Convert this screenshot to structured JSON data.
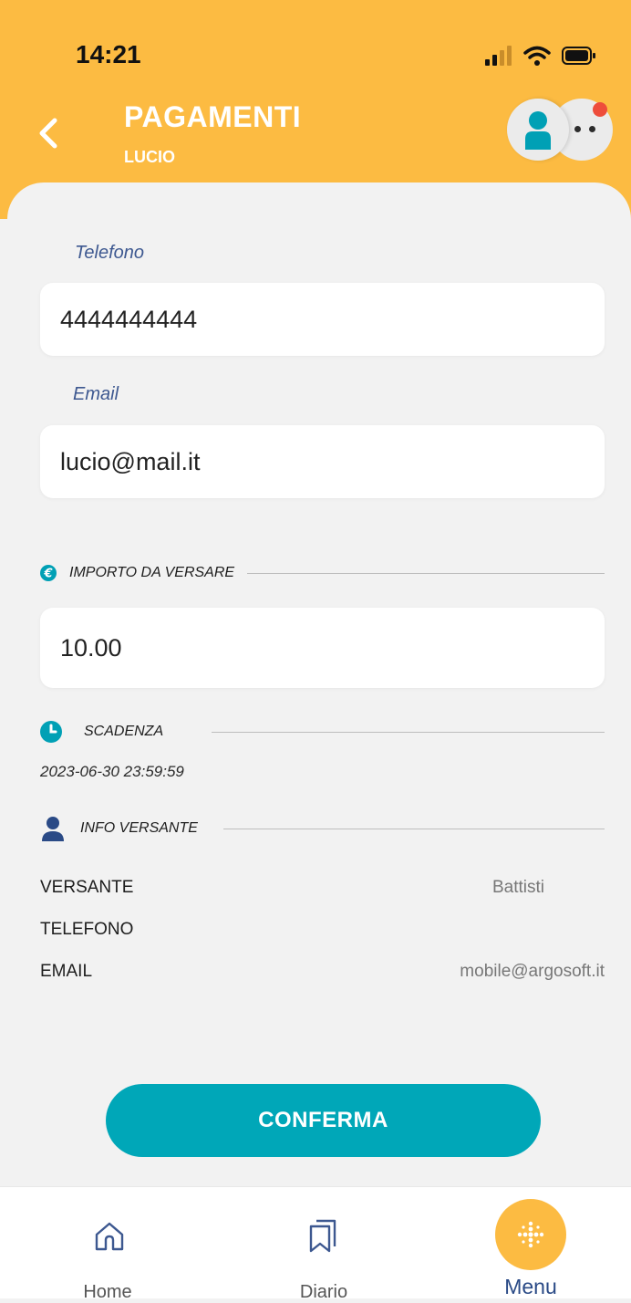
{
  "status_bar": {
    "time": "14:21"
  },
  "header": {
    "title": "PAGAMENTI",
    "subtitle": "LUCIO"
  },
  "form": {
    "phone_label": "Telefono",
    "phone_value": "4444444444",
    "email_label": "Email",
    "email_value": "lucio@mail.it"
  },
  "amount": {
    "section_label": "IMPORTO DA VERSARE",
    "value": "10.00"
  },
  "deadline": {
    "section_label": "SCADENZA",
    "value": "2023-06-30 23:59:59"
  },
  "payer_info": {
    "section_label": "INFO VERSANTE",
    "rows": [
      {
        "key": "VERSANTE",
        "value": "Battisti"
      },
      {
        "key": "TELEFONO",
        "value": ""
      },
      {
        "key": "EMAIL",
        "value": "mobile@argosoft.it"
      }
    ]
  },
  "confirm_label": "CONFERMA",
  "tabbar": {
    "home_label": "Home",
    "diary_label": "Diario",
    "menu_label": "Menu"
  },
  "colors": {
    "header": "#fcbb42",
    "accent": "#00a7b8",
    "label": "#3d5890",
    "notification": "#ee4d3b"
  }
}
